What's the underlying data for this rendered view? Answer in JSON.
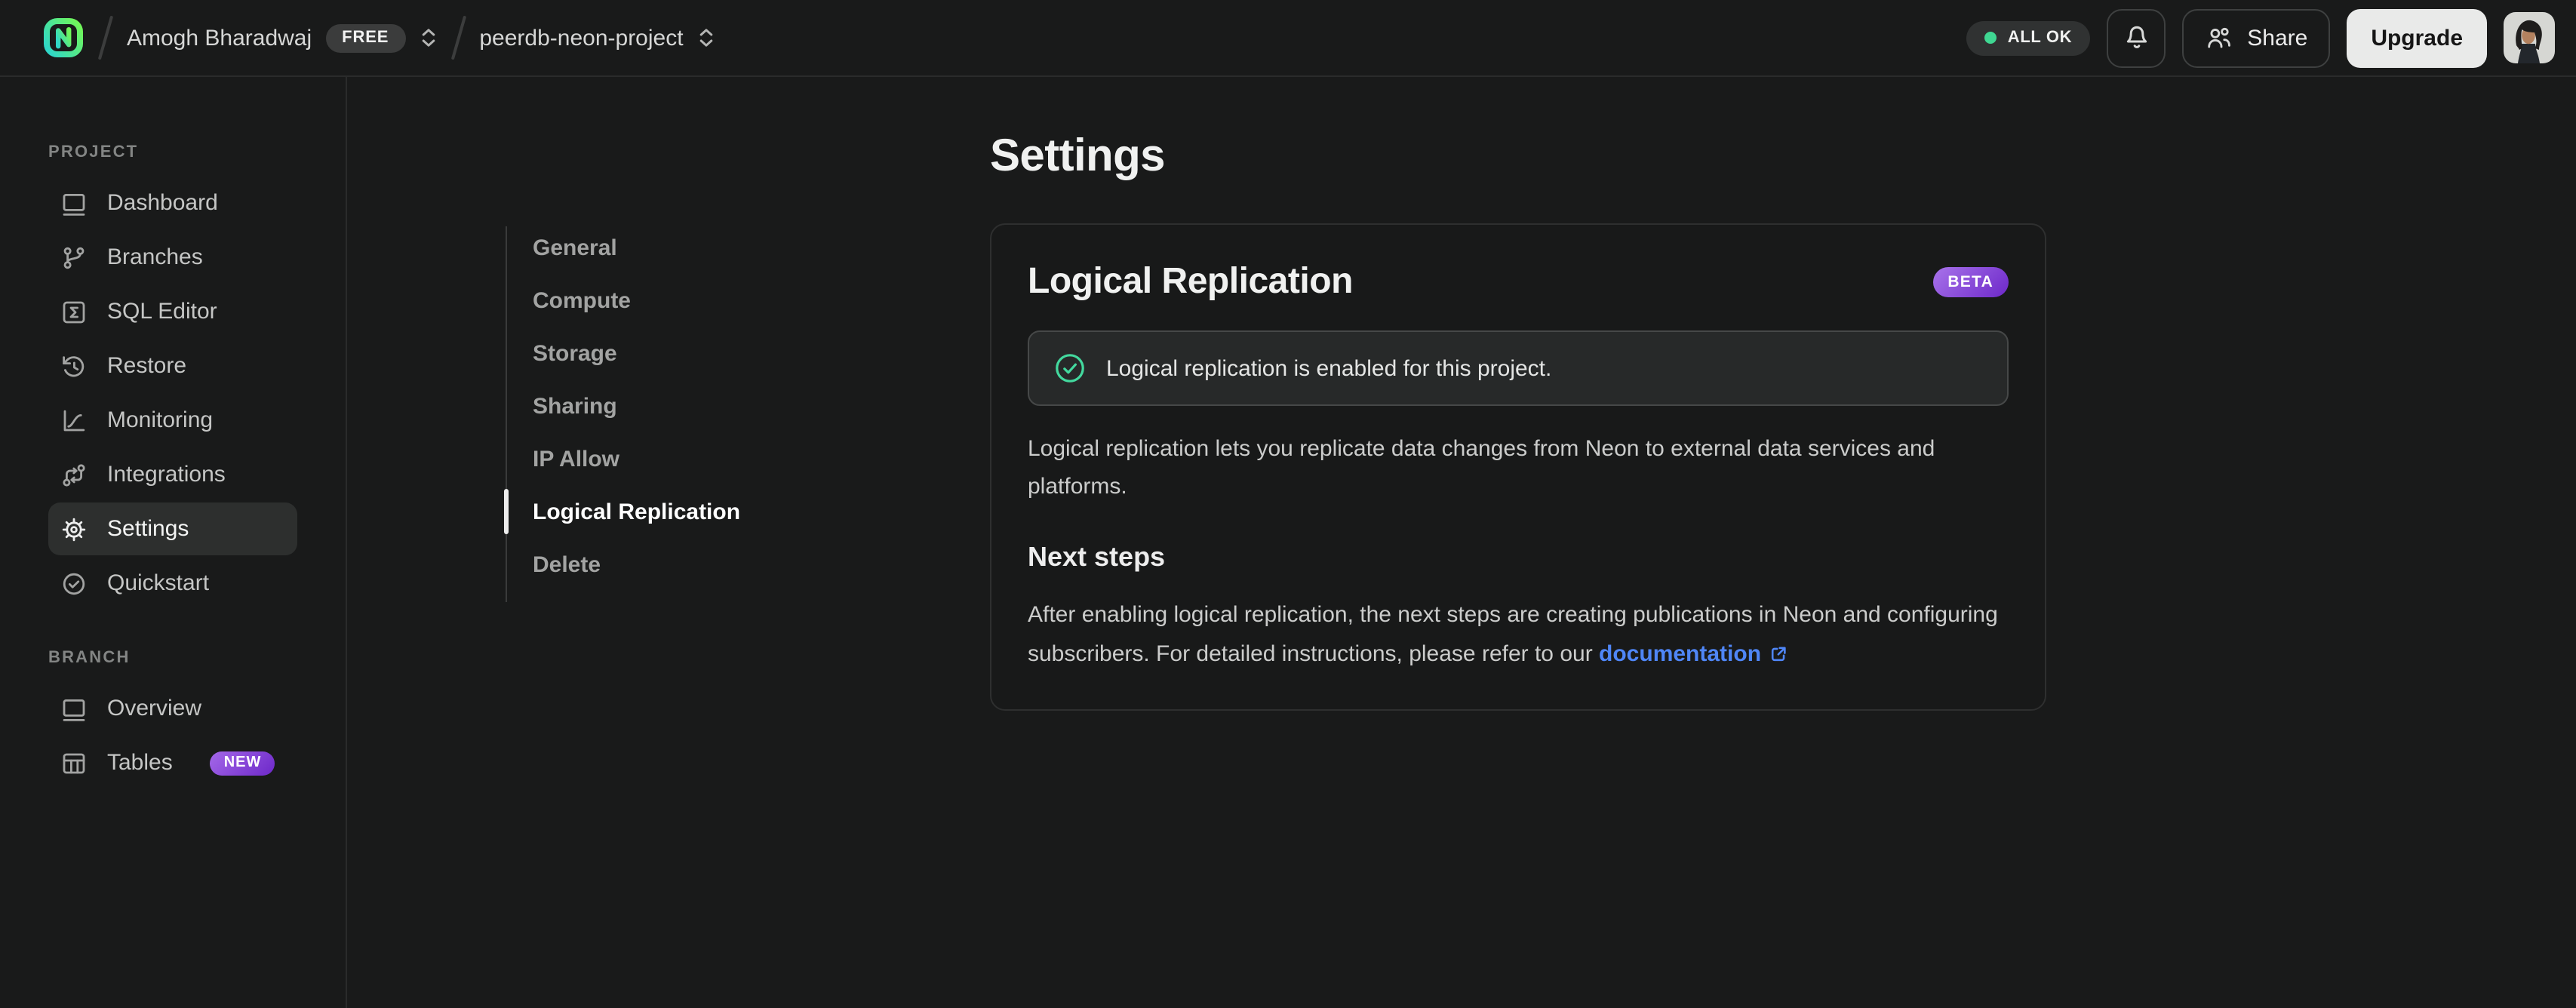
{
  "header": {
    "org_name": "Amogh Bharadwaj",
    "org_badge": "FREE",
    "project_name": "peerdb-neon-project",
    "status_label": "ALL OK",
    "share_label": "Share",
    "upgrade_label": "Upgrade",
    "icons": [
      "neon-logo",
      "bell-icon",
      "users-icon",
      "avatar"
    ]
  },
  "sidebar": {
    "project_label": "PROJECT",
    "project_items": [
      {
        "label": "Dashboard",
        "icon": "dashboard-window-icon"
      },
      {
        "label": "Branches",
        "icon": "git-branch-icon"
      },
      {
        "label": "SQL Editor",
        "icon": "sql-terminal-icon"
      },
      {
        "label": "Restore",
        "icon": "history-clock-icon"
      },
      {
        "label": "Monitoring",
        "icon": "chart-curve-icon"
      },
      {
        "label": "Integrations",
        "icon": "workflow-nodes-icon"
      },
      {
        "label": "Settings",
        "icon": "gear-icon",
        "active": true
      },
      {
        "label": "Quickstart",
        "icon": "check-circle-icon"
      }
    ],
    "branch_label": "BRANCH",
    "branch_items": [
      {
        "label": "Overview",
        "icon": "dashboard-window-icon"
      },
      {
        "label": "Tables",
        "icon": "table-grid-icon",
        "badge": "NEW"
      }
    ]
  },
  "settings_nav": {
    "items": [
      "General",
      "Compute",
      "Storage",
      "Sharing",
      "IP Allow",
      "Logical Replication",
      "Delete"
    ],
    "active": "Logical Replication"
  },
  "main": {
    "page_title": "Settings",
    "card": {
      "title": "Logical Replication",
      "badge": "BETA",
      "banner_text": "Logical replication is enabled for this project.",
      "description": "Logical replication lets you replicate data changes from Neon to external data services and platforms.",
      "next_steps_title": "Next steps",
      "next_steps_text": "After enabling logical replication, the next steps are creating publications in Neon and configuring subscribers. For detailed instructions, please refer to our ",
      "link_text": "documentation"
    }
  },
  "colors": {
    "background": "#191a1a",
    "card_background": "#181919",
    "banner_background": "#272929",
    "border": "#2e2f2f",
    "success_green": "#43d99e",
    "status_dot_green": "#3fd792",
    "badge_purple_start": "#a873ea",
    "badge_purple_end": "#6d28c9",
    "link_blue": "#4f86f7",
    "logo_gradient": [
      "#2fd7c8",
      "#70f65a"
    ]
  }
}
